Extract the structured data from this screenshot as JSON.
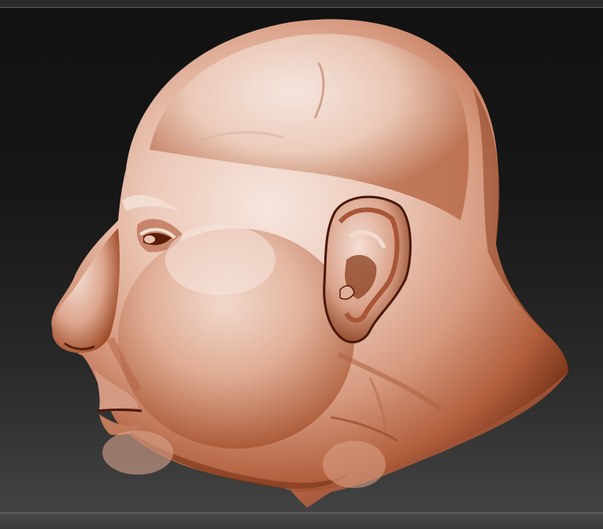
{
  "viewport": {
    "model": "sculpted-head",
    "material_colors": {
      "highlight": "#f6e4da",
      "mid": "#d5967e",
      "shadow": "#7a3418",
      "cavity": "#4a1808"
    },
    "background_colors": {
      "top": "#121212",
      "bottom": "#464646"
    }
  }
}
